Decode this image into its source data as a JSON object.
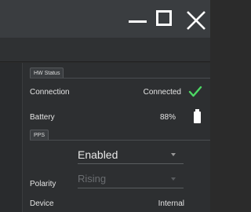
{
  "window": {
    "minimize_icon": "minimize-icon",
    "maximize_icon": "maximize-icon",
    "close_icon": "close-icon"
  },
  "hw_status": {
    "tab_label": "HW Status",
    "connection_label": "Connection",
    "connection_value": "Connected",
    "connection_icon": "checkmark-icon",
    "battery_label": "Battery",
    "battery_value": "88%",
    "battery_icon": "battery-icon"
  },
  "pps": {
    "tab_label": "PPS",
    "mode_value": "Enabled",
    "polarity_label": "Polarity",
    "polarity_value": "Rising",
    "device_label": "Device",
    "device_value": "Internal"
  },
  "colors": {
    "accent_green": "#4cd964",
    "background": "#2d2f31",
    "disabled_text": "#6a6d70"
  }
}
